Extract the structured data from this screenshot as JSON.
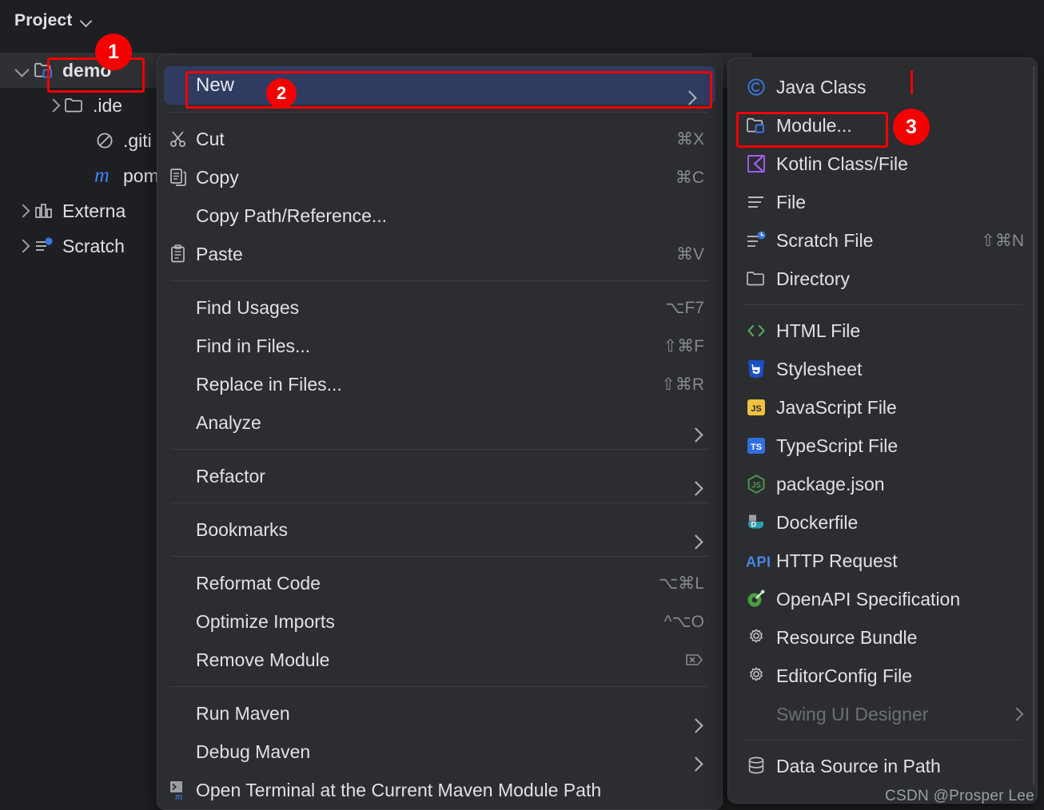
{
  "project_pane": {
    "header": {
      "title": "Project",
      "chevron_icon": "chevron-down-icon"
    },
    "tree": [
      {
        "label": "demo",
        "indent": 0,
        "twisty": "down",
        "icon": "module-folder-icon",
        "bold": true,
        "selected": true
      },
      {
        "label": ".ide",
        "indent": 1,
        "twisty": "right",
        "icon": "folder-icon",
        "bold": false,
        "selected": false
      },
      {
        "label": ".giti",
        "indent": 2,
        "twisty": "none",
        "icon": "gitignore-icon",
        "bold": false,
        "selected": false
      },
      {
        "label": "pom",
        "indent": 2,
        "twisty": "none",
        "icon": "maven-m-icon",
        "bold": false,
        "selected": false
      },
      {
        "label": "Externa",
        "indent": 0,
        "twisty": "right",
        "icon": "external-libs-icon",
        "bold": false,
        "selected": false
      },
      {
        "label": "Scratch",
        "indent": 0,
        "twisty": "right",
        "icon": "scratches-icon",
        "bold": false,
        "selected": false
      }
    ]
  },
  "context_menu": {
    "items": [
      {
        "type": "item",
        "label": "New",
        "icon": "none",
        "shortcut": "",
        "arrow": true,
        "highlight": true
      },
      {
        "type": "sep"
      },
      {
        "type": "item",
        "label": "Cut",
        "icon": "scissors-icon",
        "shortcut": "⌘X",
        "arrow": false,
        "highlight": false
      },
      {
        "type": "item",
        "label": "Copy",
        "icon": "copy-icon",
        "shortcut": "⌘C",
        "arrow": false,
        "highlight": false
      },
      {
        "type": "item",
        "label": "Copy Path/Reference...",
        "icon": "none",
        "shortcut": "",
        "arrow": false,
        "highlight": false
      },
      {
        "type": "item",
        "label": "Paste",
        "icon": "paste-icon",
        "shortcut": "⌘V",
        "arrow": false,
        "highlight": false
      },
      {
        "type": "sep"
      },
      {
        "type": "item",
        "label": "Find Usages",
        "icon": "none",
        "shortcut": "⌥F7",
        "arrow": false,
        "highlight": false
      },
      {
        "type": "item",
        "label": "Find in Files...",
        "icon": "none",
        "shortcut": "⇧⌘F",
        "arrow": false,
        "highlight": false
      },
      {
        "type": "item",
        "label": "Replace in Files...",
        "icon": "none",
        "shortcut": "⇧⌘R",
        "arrow": false,
        "highlight": false
      },
      {
        "type": "item",
        "label": "Analyze",
        "icon": "none",
        "shortcut": "",
        "arrow": true,
        "highlight": false
      },
      {
        "type": "sep"
      },
      {
        "type": "item",
        "label": "Refactor",
        "icon": "none",
        "shortcut": "",
        "arrow": true,
        "highlight": false
      },
      {
        "type": "sep"
      },
      {
        "type": "item",
        "label": "Bookmarks",
        "icon": "none",
        "shortcut": "",
        "arrow": true,
        "highlight": false
      },
      {
        "type": "sep"
      },
      {
        "type": "item",
        "label": "Reformat Code",
        "icon": "none",
        "shortcut": "⌥⌘L",
        "arrow": false,
        "highlight": false
      },
      {
        "type": "item",
        "label": "Optimize Imports",
        "icon": "none",
        "shortcut": "^⌥O",
        "arrow": false,
        "highlight": false
      },
      {
        "type": "item",
        "label": "Remove Module",
        "icon": "none",
        "shortcut": "delete-tag-icon",
        "arrow": false,
        "highlight": false
      },
      {
        "type": "sep"
      },
      {
        "type": "item",
        "label": "Run Maven",
        "icon": "none",
        "shortcut": "",
        "arrow": true,
        "highlight": false
      },
      {
        "type": "item",
        "label": "Debug Maven",
        "icon": "none",
        "shortcut": "",
        "arrow": true,
        "highlight": false
      },
      {
        "type": "item",
        "label": "Open Terminal at the Current Maven Module Path",
        "icon": "terminal-maven-icon",
        "shortcut": "",
        "arrow": false,
        "highlight": false
      }
    ]
  },
  "submenu": {
    "items": [
      {
        "type": "item",
        "label": "Java Class",
        "icon": "java-class-icon",
        "shortcut": "",
        "arrow": false,
        "disabled": false
      },
      {
        "type": "item",
        "label": "Module...",
        "icon": "module-folder-icon",
        "shortcut": "",
        "arrow": false,
        "disabled": false
      },
      {
        "type": "item",
        "label": "Kotlin Class/File",
        "icon": "kotlin-icon",
        "shortcut": "",
        "arrow": false,
        "disabled": false
      },
      {
        "type": "item",
        "label": "File",
        "icon": "file-lines-icon",
        "shortcut": "",
        "arrow": false,
        "disabled": false
      },
      {
        "type": "item",
        "label": "Scratch File",
        "icon": "scratch-file-icon",
        "shortcut": "⇧⌘N",
        "arrow": false,
        "disabled": false
      },
      {
        "type": "item",
        "label": "Directory",
        "icon": "folder-icon",
        "shortcut": "",
        "arrow": false,
        "disabled": false
      },
      {
        "type": "sep"
      },
      {
        "type": "item",
        "label": "HTML File",
        "icon": "html-icon",
        "shortcut": "",
        "arrow": false,
        "disabled": false
      },
      {
        "type": "item",
        "label": "Stylesheet",
        "icon": "css-icon",
        "shortcut": "",
        "arrow": false,
        "disabled": false
      },
      {
        "type": "item",
        "label": "JavaScript File",
        "icon": "js-icon",
        "shortcut": "",
        "arrow": false,
        "disabled": false
      },
      {
        "type": "item",
        "label": "TypeScript File",
        "icon": "ts-icon",
        "shortcut": "",
        "arrow": false,
        "disabled": false
      },
      {
        "type": "item",
        "label": "package.json",
        "icon": "nodejs-icon",
        "shortcut": "",
        "arrow": false,
        "disabled": false
      },
      {
        "type": "item",
        "label": "Dockerfile",
        "icon": "docker-icon",
        "shortcut": "",
        "arrow": false,
        "disabled": false
      },
      {
        "type": "item",
        "label": "HTTP Request",
        "icon": "api-icon",
        "shortcut": "",
        "arrow": false,
        "disabled": false
      },
      {
        "type": "item",
        "label": "OpenAPI Specification",
        "icon": "openapi-icon",
        "shortcut": "",
        "arrow": false,
        "disabled": false
      },
      {
        "type": "item",
        "label": "Resource Bundle",
        "icon": "gear-icon",
        "shortcut": "",
        "arrow": false,
        "disabled": false
      },
      {
        "type": "item",
        "label": "EditorConfig File",
        "icon": "gear-icon",
        "shortcut": "",
        "arrow": false,
        "disabled": false
      },
      {
        "type": "item",
        "label": "Swing UI Designer",
        "icon": "none",
        "shortcut": "",
        "arrow": true,
        "disabled": true
      },
      {
        "type": "sep"
      },
      {
        "type": "item",
        "label": "Data Source in Path",
        "icon": "database-icon",
        "shortcut": "",
        "arrow": false,
        "disabled": false
      }
    ]
  },
  "annotations": [
    {
      "id": "1",
      "label": "1"
    },
    {
      "id": "2",
      "label": "2"
    },
    {
      "id": "3",
      "label": "3"
    }
  ],
  "watermark": {
    "text": "CSDN @Prosper Lee"
  },
  "colors": {
    "window_bg": "#1e1f22",
    "menu_bg": "#2b2d30",
    "highlight_blue": "#2f3b61",
    "annotation_red": "#f40000",
    "text": "#dfe1e5",
    "muted_text": "#868a91"
  }
}
